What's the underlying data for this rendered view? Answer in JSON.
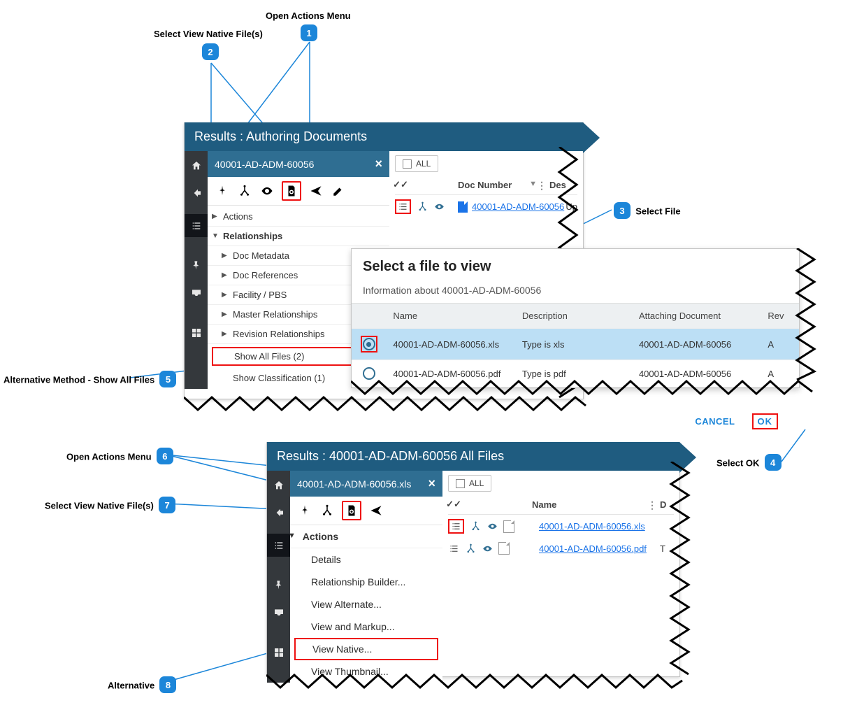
{
  "callouts": {
    "c1": "Open Actions Menu",
    "c2": "Select View Native File(s)",
    "c3": "Select File",
    "c4": "Select OK",
    "c5": "Alternative Method - Show All Files",
    "c6": "Open Actions Menu",
    "c7": "Select View Native File(s)",
    "c8": "Alternative",
    "b1": "1",
    "b2": "2",
    "b3": "3",
    "b4": "4",
    "b5": "5",
    "b6": "6",
    "b7": "7",
    "b8": "8"
  },
  "panel1": {
    "title": "Results : Authoring Documents",
    "crumb": "40001-AD-ADM-60056",
    "all_label": "ALL",
    "grid": {
      "col_doc": "Doc Number",
      "col_des": "Des",
      "row_doc": "40001-AD-ADM-60056",
      "row_des": "Up"
    },
    "tree": {
      "actions": "Actions",
      "rel": "Relationships",
      "meta": "Doc Metadata",
      "refs": "Doc References",
      "fac": "Facility / PBS",
      "master": "Master Relationships",
      "rev": "Revision Relationships",
      "show_all": "Show All Files (2)",
      "show_class": "Show Classification (1)"
    }
  },
  "dialog": {
    "title": "Select a file to view",
    "sub": "Information about 40001-AD-ADM-60056",
    "cols": {
      "name": "Name",
      "desc": "Description",
      "attach": "Attaching Document",
      "rev": "Rev"
    },
    "rows": [
      {
        "name": "40001-AD-ADM-60056.xls",
        "desc": "Type is xls",
        "attach": "40001-AD-ADM-60056",
        "rev": "A",
        "selected": true
      },
      {
        "name": "40001-AD-ADM-60056.pdf",
        "desc": "Type is pdf",
        "attach": "40001-AD-ADM-60056",
        "rev": "A",
        "selected": false
      }
    ],
    "cancel": "CANCEL",
    "ok": "OK"
  },
  "panel2": {
    "title": "Results : 40001-AD-ADM-60056 All Files",
    "crumb": "40001-AD-ADM-60056.xls",
    "all_label": "ALL",
    "col_name": "Name",
    "col_d": "D",
    "files": [
      "40001-AD-ADM-60056.xls",
      "40001-AD-ADM-60056.pdf"
    ],
    "row2_t": "T",
    "actions_hdr": "Actions",
    "actions": [
      "Details",
      "Relationship Builder...",
      "View Alternate...",
      "View and Markup...",
      "View Native...",
      "View Thumbnail..."
    ]
  }
}
